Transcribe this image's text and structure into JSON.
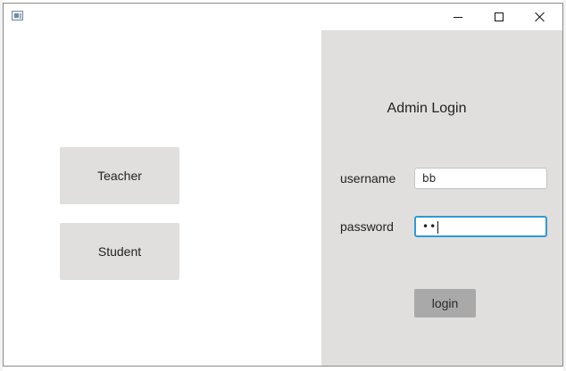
{
  "window": {
    "minimize_icon": "minimize-icon",
    "maximize_icon": "maximize-icon",
    "close_icon": "close-icon"
  },
  "left": {
    "teacher_label": "Teacher",
    "student_label": "Student"
  },
  "admin": {
    "title": "Admin Login",
    "username_label": "username",
    "username_value": "bb",
    "password_label": "password",
    "password_masked": "••",
    "login_label": "login"
  },
  "colors": {
    "panel_bg": "#e0dfdd",
    "focus_border": "#2e9ad6",
    "login_bg": "#a9a9a9"
  }
}
